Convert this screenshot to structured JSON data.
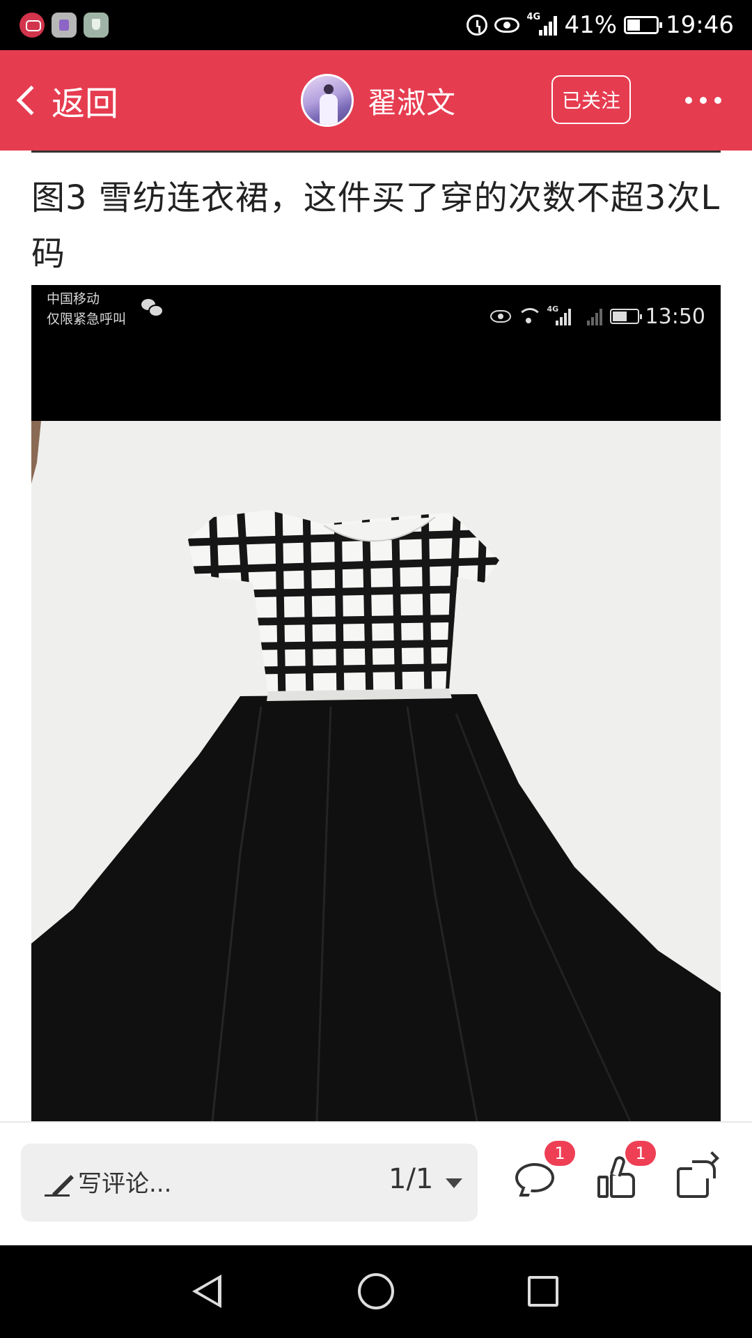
{
  "status_bar": {
    "network": "4G",
    "battery": "41%",
    "time": "19:46",
    "icons": [
      "app-icon-1",
      "app-icon-2",
      "app-icon-3",
      "alarm-icon",
      "eye-icon",
      "signal-icon",
      "battery-icon"
    ]
  },
  "header": {
    "back_label": "返回",
    "author_name": "翟淑文",
    "follow_label": "已关注",
    "accent_color": "#e63c50"
  },
  "post": {
    "caption": "图3  雪纺连衣裙，这件买了穿的次数不超3次L码",
    "image": {
      "carrier_line1": "中国移动",
      "carrier_line2": "仅限紧急呼叫",
      "network": "4G",
      "time": "13:50",
      "subject": "dress-photo"
    }
  },
  "bottom_bar": {
    "comment_placeholder": "写评论...",
    "page_indicator": "1/1",
    "comment_count": "1",
    "like_count": "1",
    "badge_color": "#ee3f55"
  }
}
